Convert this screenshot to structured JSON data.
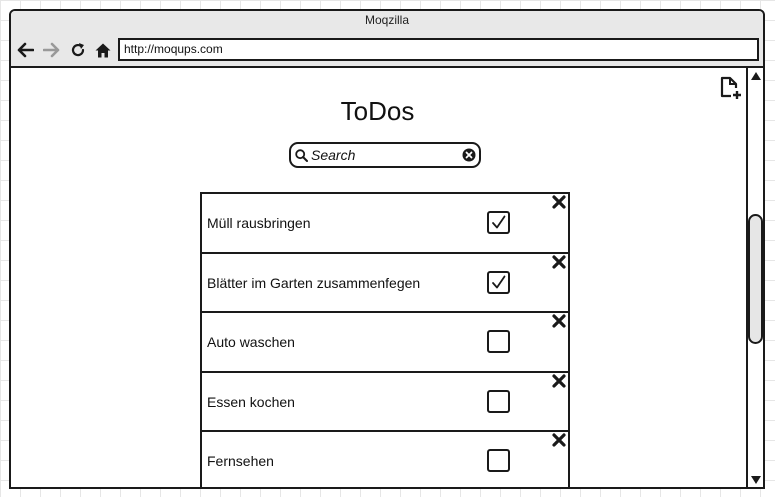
{
  "window": {
    "title": "Moqzilla",
    "url": "http://moqups.com"
  },
  "nav": {
    "back": "arrow-left-icon",
    "forward": "arrow-right-icon",
    "reload": "reload-icon",
    "home": "home-icon"
  },
  "page": {
    "heading": "ToDos",
    "new_doc_icon": "new-document-icon"
  },
  "search": {
    "placeholder": "Search",
    "value": ""
  },
  "todos": [
    {
      "label": "Müll rausbringen",
      "checked": true
    },
    {
      "label": "Blätter im Garten zusammenfegen",
      "checked": true
    },
    {
      "label": "Auto waschen",
      "checked": false
    },
    {
      "label": "Essen kochen",
      "checked": false
    },
    {
      "label": "Fernsehen",
      "checked": false
    }
  ],
  "colors": {
    "stroke": "#1a1a1a",
    "titlebar": "#e8e8e8",
    "forward_disabled": "#999999"
  }
}
